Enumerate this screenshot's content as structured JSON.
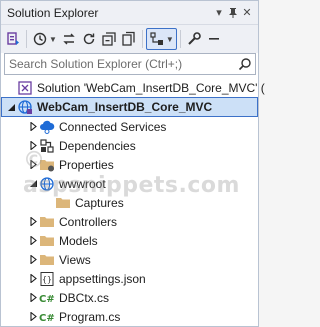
{
  "window": {
    "title": "Solution Explorer",
    "controls": [
      "▾",
      "⊥",
      "✕"
    ]
  },
  "search": {
    "placeholder": "Search Solution Explorer (Ctrl+;)"
  },
  "tree": {
    "solution_label": "Solution 'WebCam_InsertDB_Core_MVC' (",
    "project_label": "WebCam_InsertDB_Core_MVC",
    "items": [
      {
        "label": "Connected Services",
        "icon": "connected-services-icon"
      },
      {
        "label": "Dependencies",
        "icon": "dependencies-icon"
      },
      {
        "label": "Properties",
        "icon": "folder-icon"
      },
      {
        "label": "wwwroot",
        "icon": "globe-icon"
      },
      {
        "label": "Captures",
        "icon": "folder-icon"
      },
      {
        "label": "Controllers",
        "icon": "folder-icon"
      },
      {
        "label": "Models",
        "icon": "folder-icon"
      },
      {
        "label": "Views",
        "icon": "folder-icon"
      },
      {
        "label": "appsettings.json",
        "icon": "json-icon"
      },
      {
        "label": "DBCtx.cs",
        "icon": "csharp-icon"
      },
      {
        "label": "Program.cs",
        "icon": "csharp-icon"
      }
    ]
  },
  "watermark": "© aspsnippets.com",
  "colors": {
    "selection_bg": "#cce0f7",
    "selection_border": "#3c71c8",
    "folder": "#dcb67a",
    "csharp": "#388a34",
    "globe": "#1e6bd6"
  }
}
